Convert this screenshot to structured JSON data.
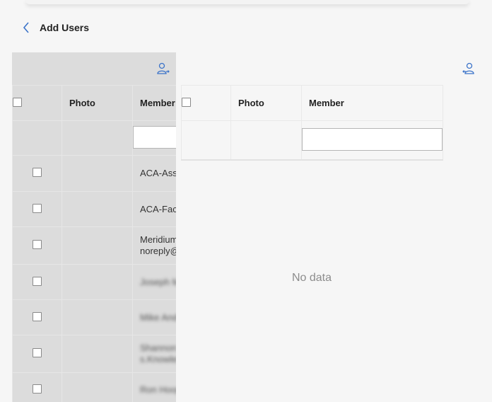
{
  "header": {
    "title": "Add Users"
  },
  "colors": {
    "accent": "#3b73c9",
    "left_panel_bg": "#dcdcdc",
    "page_bg": "#f6f6f6"
  },
  "icons": {
    "back": "chevron-left-icon",
    "add_user": "user-add-icon",
    "remove_user": "user-remove-icon"
  },
  "available": {
    "columns": {
      "photo": "Photo",
      "member": "Member"
    },
    "rows": [
      {
        "line1": "ACA-Asse",
        "line2": ""
      },
      {
        "line1": "ACA-Facil",
        "line2": ""
      },
      {
        "line1": "Meridium",
        "line2": "noreply@"
      },
      {
        "line1": "Joseph Ma",
        "line2": ""
      },
      {
        "line1": "Mike Andr",
        "line2": ""
      },
      {
        "line1": "Shannon",
        "line2": "s.Knowles"
      },
      {
        "line1": "Ron Hoop",
        "line2": ""
      }
    ]
  },
  "selected": {
    "columns": {
      "photo": "Photo",
      "member": "Member"
    },
    "empty_text": "No data"
  }
}
